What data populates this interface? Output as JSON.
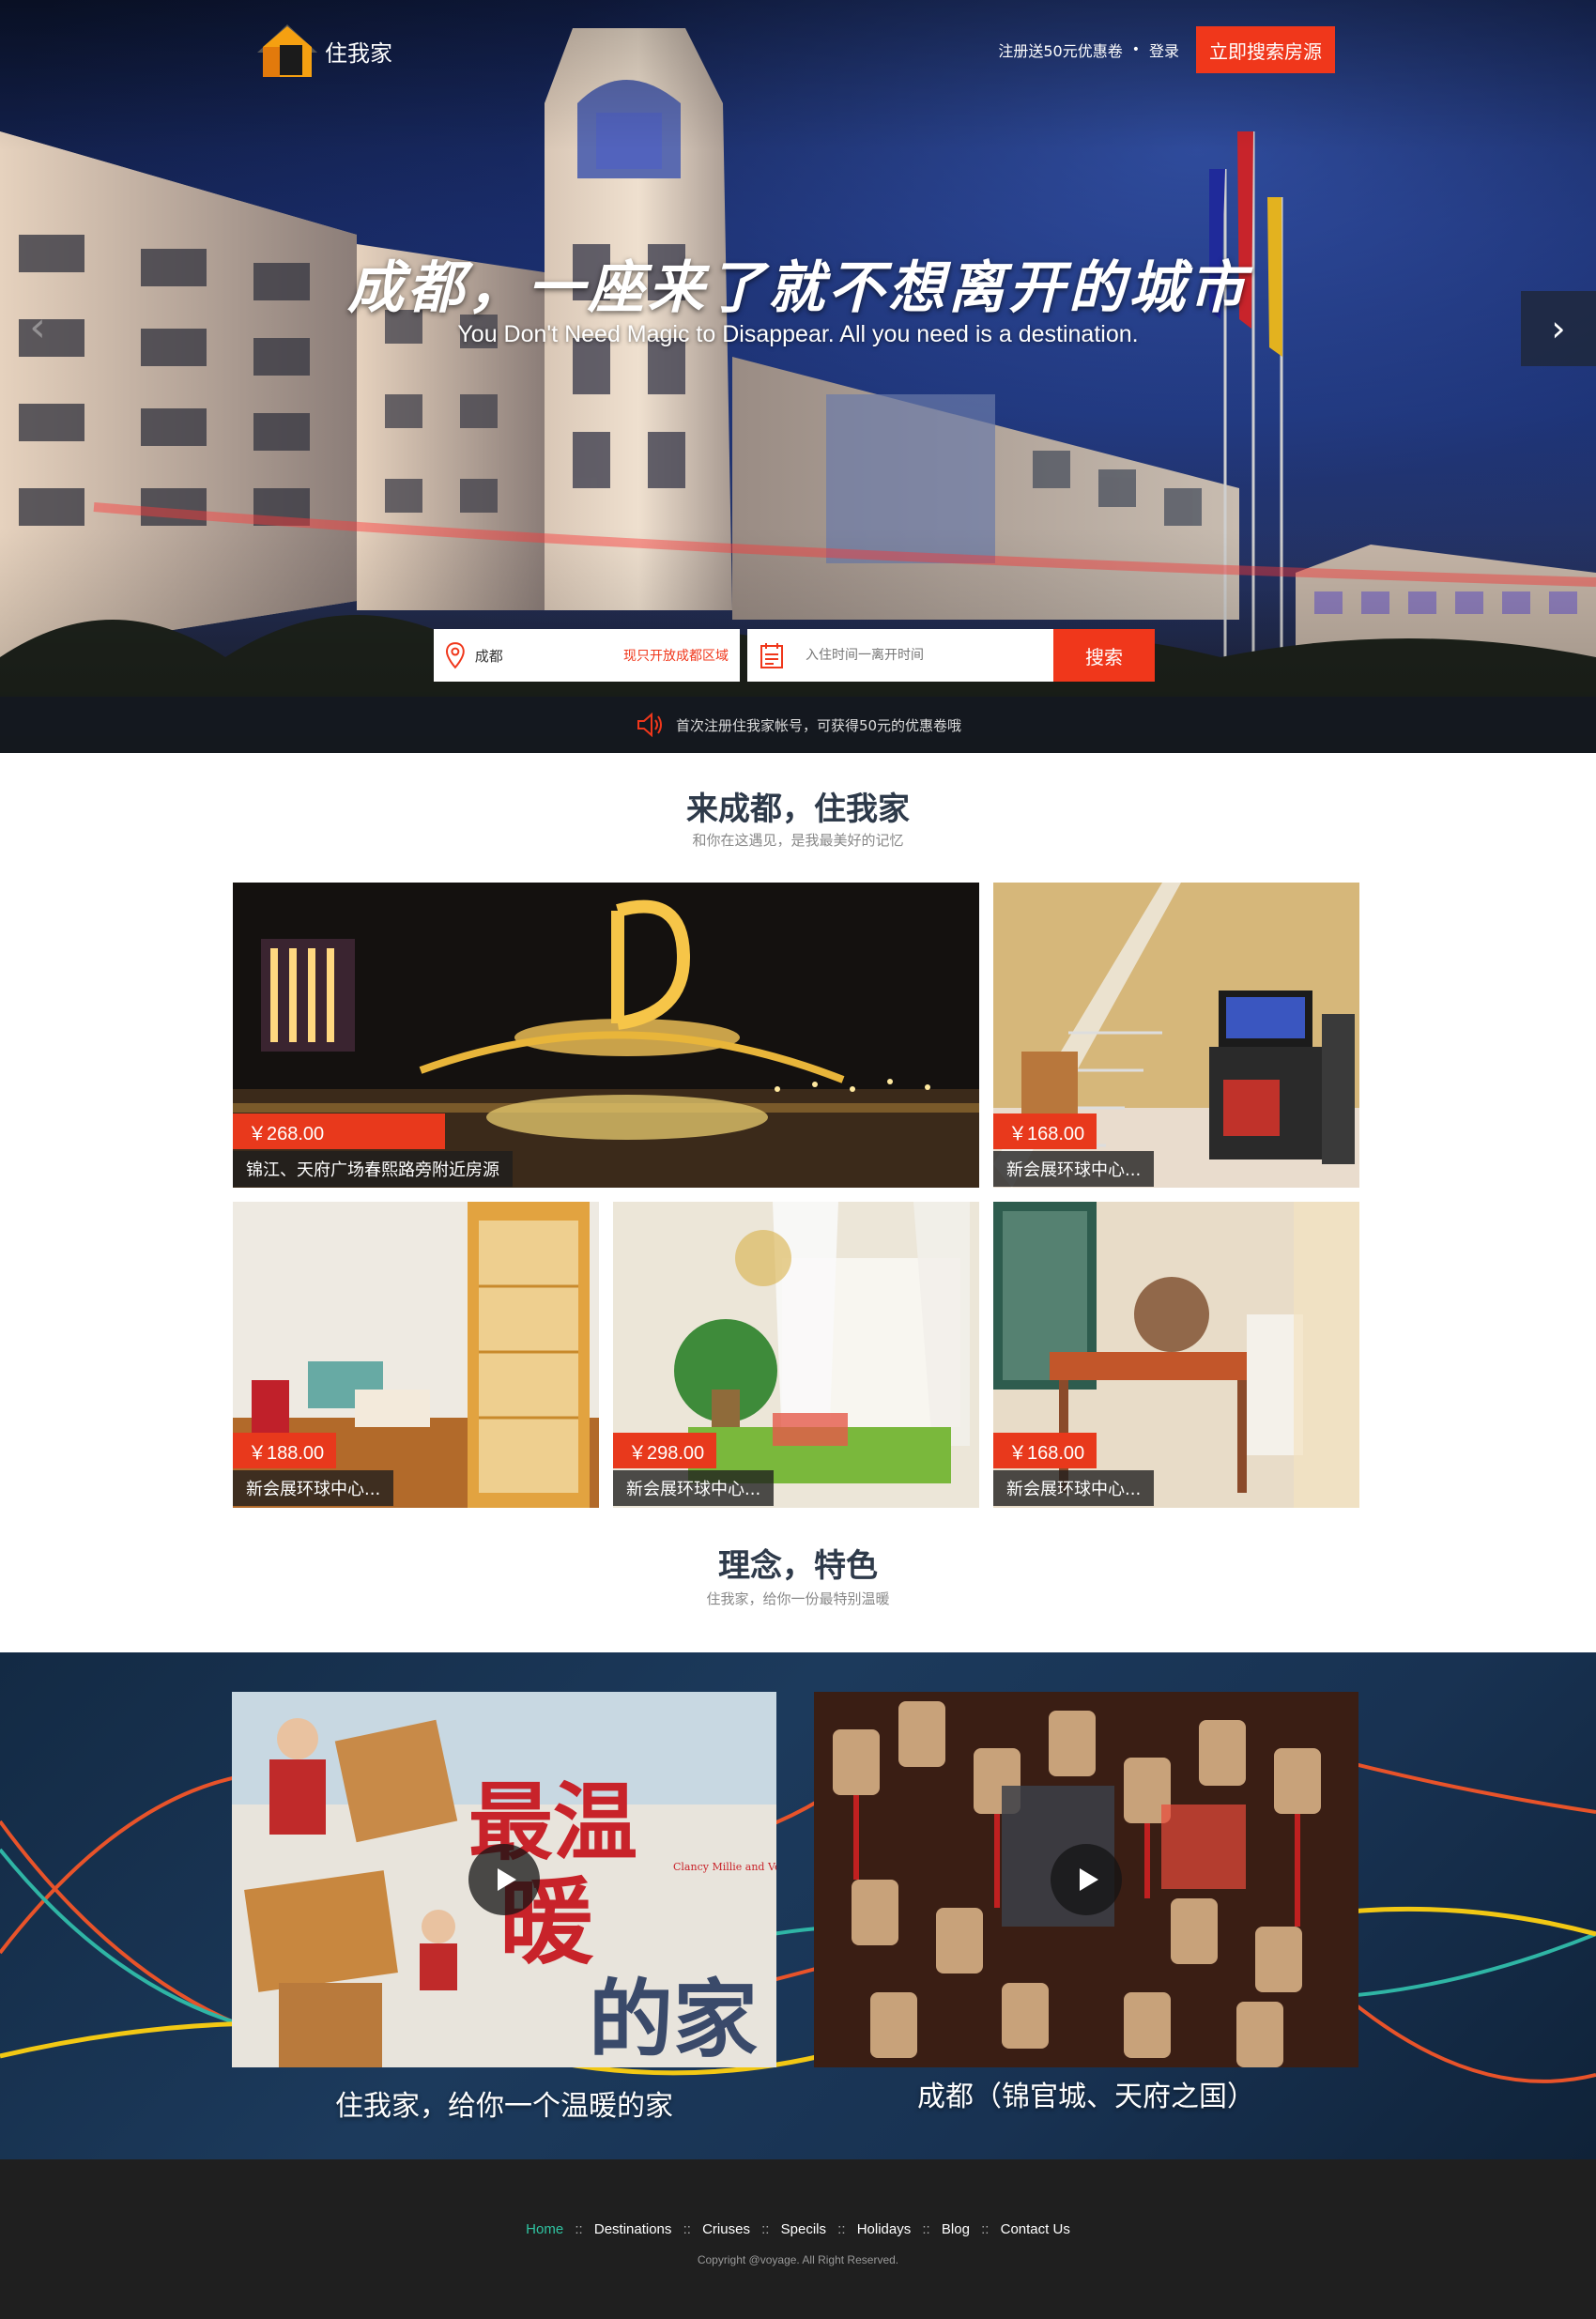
{
  "header": {
    "logo_text": "住我家",
    "promo_link": "注册送50元优惠卷",
    "separator": "•",
    "login": "登录",
    "cta_button": "立即搜索房源"
  },
  "hero": {
    "title": "成都，一座来了就不想离开的城市",
    "subtitle": "You Don't Need Magic to Disappear. All you need is a destination.",
    "prev_arrow": "‹",
    "next_arrow": "›"
  },
  "search": {
    "city_value": "成都",
    "city_hint": "现只开放成都区域",
    "date_placeholder": "入住时间一离开时间",
    "button": "搜索"
  },
  "notice": {
    "text": "首次注册住我家帐号，可获得50元的优惠卷哦"
  },
  "section1": {
    "title": "来成都，住我家",
    "subtitle": "和你在这遇见，是我最美好的记忆",
    "listings": [
      {
        "price": "￥268.00",
        "caption": "锦江、天府广场春熙路旁附近房源"
      },
      {
        "price": "￥168.00",
        "caption": "新会展环球中心..."
      },
      {
        "price": "￥188.00",
        "caption": "新会展环球中心..."
      },
      {
        "price": "￥298.00",
        "caption": "新会展环球中心..."
      },
      {
        "price": "￥168.00",
        "caption": "新会展环球中心..."
      }
    ]
  },
  "section2": {
    "title": "理念，特色",
    "subtitle": "住我家，给你一份最特别温暖"
  },
  "videos": [
    {
      "caption": "住我家，给你一个温暖的家",
      "poster_text_1": "最温",
      "poster_text_2": "暖",
      "poster_text_3": "的家",
      "poster_small": "Clancy Millie and Very Fine House"
    },
    {
      "caption": "成都（锦官城、天府之国）"
    }
  ],
  "footer": {
    "nav": [
      "Home",
      "Destinations",
      "Criuses",
      "Specils",
      "Holidays",
      "Blog",
      "Contact Us"
    ],
    "nav_sep": "::",
    "copyright": "Copyright @voyage. All Right Reserved."
  },
  "colors": {
    "accent": "#f0371b",
    "footer_bg": "#1f1f1f",
    "footer_active": "#2fc3a0",
    "band_bg": "#1c3a5c"
  }
}
